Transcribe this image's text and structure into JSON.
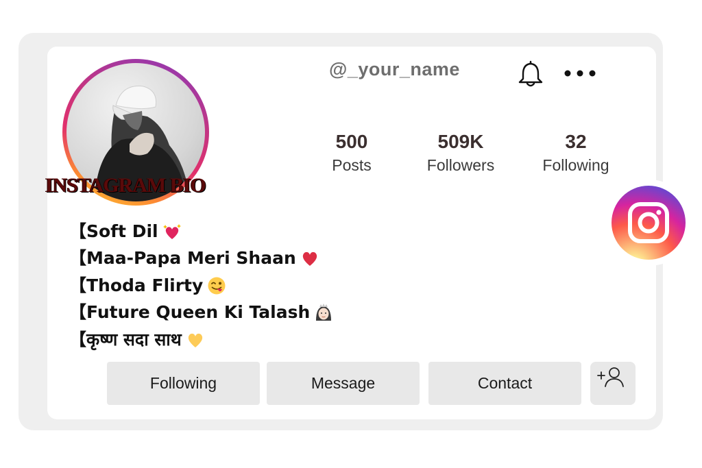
{
  "profile": {
    "username": "@_your_name",
    "brand_caption": "INSTAGRAM BIO"
  },
  "stats": [
    {
      "value": "500",
      "label": "Posts"
    },
    {
      "value": "509K",
      "label": "Followers"
    },
    {
      "value": "32",
      "label": "Following"
    }
  ],
  "bio": [
    {
      "text": "【Soft Dil",
      "emoji": "heart-with-sparkles-icon"
    },
    {
      "text": "【Maa-Papa Meri Shaan",
      "emoji": "red-heart-icon"
    },
    {
      "text": "【Thoda Flirty",
      "emoji": "winking-tongue-face-icon"
    },
    {
      "text": "【Future Queen Ki Talash",
      "emoji": "princess-face-icon"
    },
    {
      "text": "【कृष्ण सदा साथ",
      "emoji": "yellow-heart-icon"
    }
  ],
  "actions": {
    "following_label": "Following",
    "message_label": "Message",
    "contact_label": "Contact"
  },
  "icons": {
    "notifications": "bell-icon",
    "more": "more-options-icon",
    "add_user": "add-user-icon",
    "badge": "instagram-logo-icon"
  },
  "colors": {
    "ring_gradient": [
      "#8a3ab9",
      "#c13584",
      "#e1306c",
      "#fd8d32",
      "#fcc932"
    ],
    "button_bg": "#e8e8e8",
    "frame_bg": "#efefef"
  }
}
